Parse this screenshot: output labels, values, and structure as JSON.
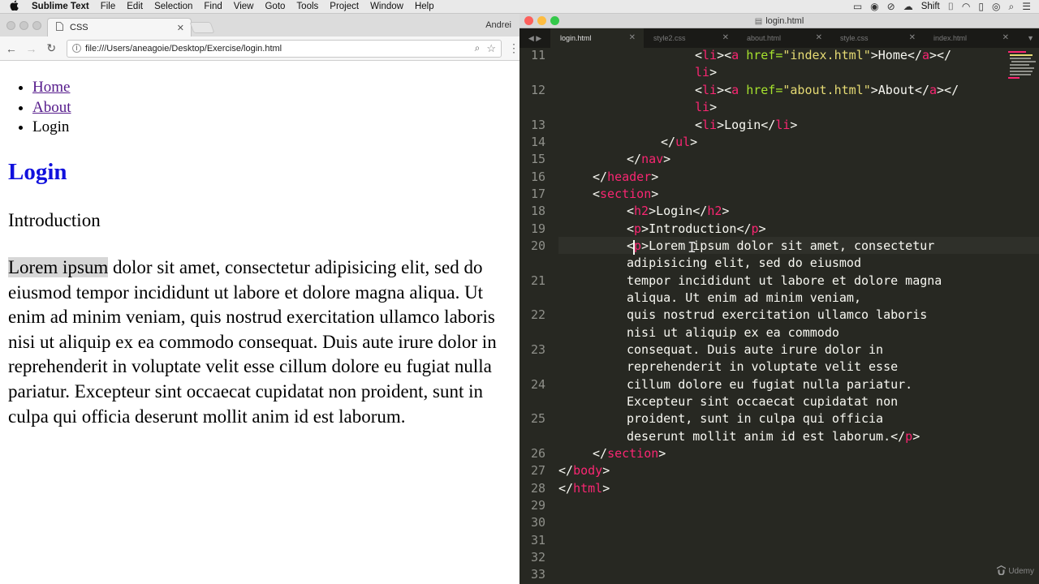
{
  "menubar": {
    "apple": "",
    "items": [
      "Sublime Text",
      "File",
      "Edit",
      "Selection",
      "Find",
      "View",
      "Goto",
      "Tools",
      "Project",
      "Window",
      "Help"
    ],
    "shift": "Shift"
  },
  "browser": {
    "tab_title": "CSS",
    "user": "Andrei",
    "url": "file:///Users/aneagoie/Desktop/Exercise/login.html",
    "page": {
      "nav": [
        "Home",
        "About",
        "Login"
      ],
      "heading": "Login",
      "intro": "Introduction",
      "lorem_selected": "Lorem ipsum",
      "lorem_rest": " dolor sit amet, consectetur adipisicing elit, sed do eiusmod tempor incididunt ut labore et dolore magna aliqua. Ut enim ad minim veniam, quis nostrud exercitation ullamco laboris nisi ut aliquip ex ea commodo consequat. Duis aute irure dolor in reprehenderit in voluptate velit esse cillum dolore eu fugiat nulla pariatur. Excepteur sint occaecat cupidatat non proident, sunt in culpa qui officia deserunt mollit anim id est laborum."
    }
  },
  "editor": {
    "window_title": "login.html",
    "tabs": [
      "login.html",
      "style2.css",
      "about.html",
      "style.css",
      "index.html"
    ],
    "line_numbers": [
      "11",
      "12",
      "13",
      "14",
      "15",
      "16",
      "17",
      "18",
      "19",
      "20",
      "21",
      "22",
      "23",
      "24",
      "25",
      "26",
      "27",
      "28",
      "29",
      "30",
      "31",
      "32",
      "33"
    ],
    "code": {
      "l11a": [
        "<",
        "li",
        "><",
        "a",
        " href=",
        "\"index.html\"",
        ">Home</",
        "a",
        "></"
      ],
      "l11b": [
        "li",
        ">"
      ],
      "l12a": [
        "<",
        "li",
        "><",
        "a",
        " href=",
        "\"about.html\"",
        ">About</",
        "a",
        "></"
      ],
      "l12b": [
        "li",
        ">"
      ],
      "l13": [
        "<",
        "li",
        ">Login</",
        "li",
        ">"
      ],
      "l14": [
        "</",
        "ul",
        ">"
      ],
      "l15": [
        "</",
        "nav",
        ">"
      ],
      "l16": [
        "</",
        "header",
        ">"
      ],
      "l17": [
        "<",
        "section",
        ">"
      ],
      "l18": [
        "<",
        "h2",
        ">Login</",
        "h2",
        ">"
      ],
      "l19": [
        "<",
        "p",
        ">Introduction</",
        "p",
        ">"
      ],
      "l20a": [
        "<",
        "p",
        ">Lorem ipsum dolor sit amet, consectetur"
      ],
      "l20b": "adipisicing elit, sed do eiusmod",
      "l21a": "tempor incididunt ut labore et dolore magna",
      "l21b": "aliqua. Ut enim ad minim veniam,",
      "l22a": "quis nostrud exercitation ullamco laboris",
      "l22b": "nisi ut aliquip ex ea commodo",
      "l23a": "consequat. Duis aute irure dolor in",
      "l23b": "reprehenderit in voluptate velit esse",
      "l24a": "cillum dolore eu fugiat nulla pariatur.",
      "l24b": "Excepteur sint occaecat cupidatat non",
      "l25a": "proident, sunt in culpa qui officia",
      "l25b": [
        "deserunt mollit anim id est laborum.</",
        "p",
        ">"
      ],
      "l26": [
        "</",
        "section",
        ">"
      ],
      "l27": [
        "</",
        "body",
        ">"
      ],
      "l28": [
        "</",
        "html",
        ">"
      ]
    }
  },
  "watermark": "Udemy",
  "colors": {
    "editor_bg": "#272822",
    "tag": "#f92672",
    "attr": "#a6e22e",
    "string": "#e6db74",
    "link_visited": "#551a8b",
    "heading_blue": "#1111dd"
  }
}
